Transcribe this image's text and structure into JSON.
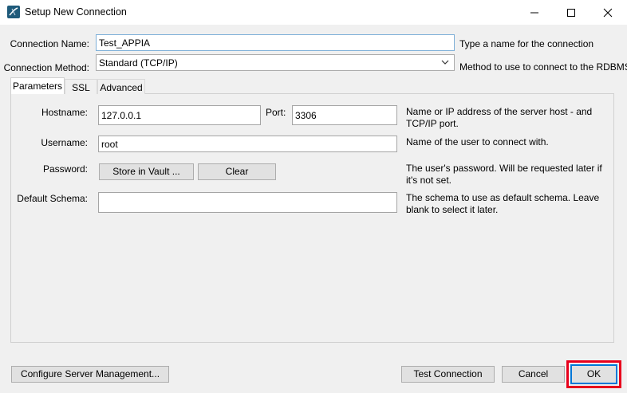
{
  "window": {
    "title": "Setup New Connection"
  },
  "form": {
    "connection_name": {
      "label": "Connection Name:",
      "value": "Test_APPIA",
      "hint": "Type a name for the connection"
    },
    "connection_method": {
      "label": "Connection Method:",
      "value": "Standard (TCP/IP)",
      "hint": "Method to use to connect to the RDBMS"
    }
  },
  "tabs": [
    {
      "label": "Parameters"
    },
    {
      "label": "SSL"
    },
    {
      "label": "Advanced"
    }
  ],
  "parameters": {
    "hostname": {
      "label": "Hostname:",
      "value": "127.0.0.1"
    },
    "port": {
      "label": "Port:",
      "value": "3306",
      "hint": "Name or IP address of the server host - and TCP/IP port."
    },
    "username": {
      "label": "Username:",
      "value": "root",
      "hint": "Name of the user to connect with."
    },
    "password": {
      "label": "Password:",
      "store_label": "Store in Vault ...",
      "clear_label": "Clear",
      "hint": "The user's password. Will be requested later if it's not set."
    },
    "default_schema": {
      "label": "Default Schema:",
      "value": "",
      "hint": "The schema to use as default schema. Leave blank to select it later."
    }
  },
  "footer": {
    "configure_label": "Configure Server Management...",
    "test_label": "Test Connection",
    "cancel_label": "Cancel",
    "ok_label": "OK"
  },
  "colors": {
    "highlight": "#e8001c",
    "accent": "#0078d7"
  }
}
